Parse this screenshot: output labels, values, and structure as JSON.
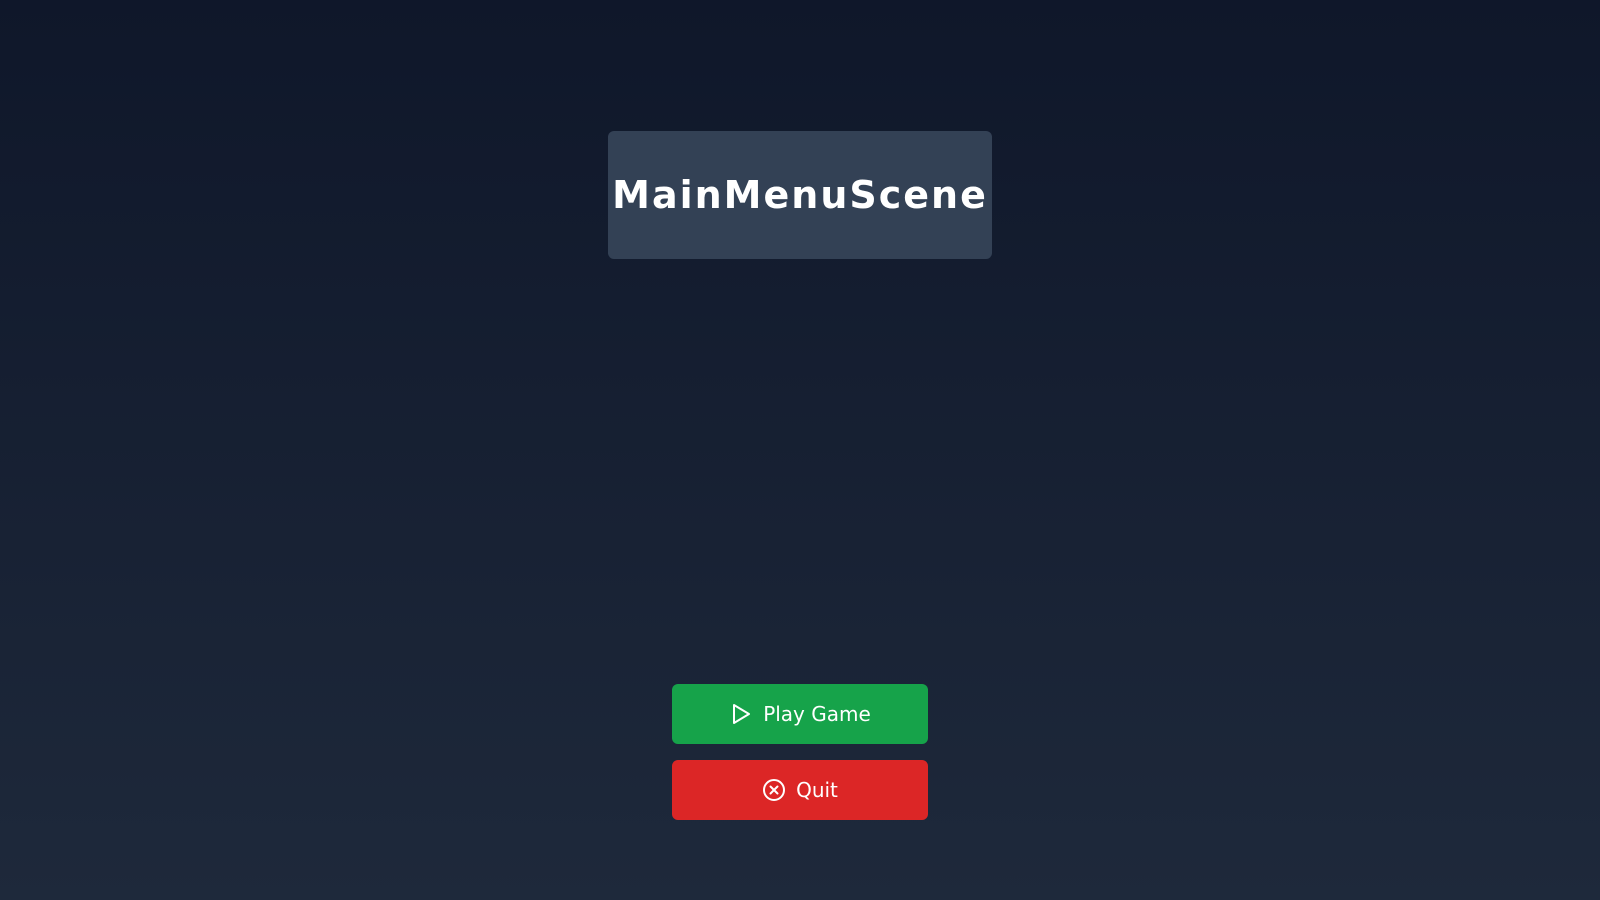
{
  "scene": {
    "title": "MainMenuScene",
    "background_top": "#0f172a",
    "background_bottom": "#1e293b",
    "panel_color": "#334155"
  },
  "menu": {
    "play": {
      "label": "Play Game",
      "icon": "play-icon",
      "color": "#16a34a"
    },
    "quit": {
      "label": "Quit",
      "icon": "close-circle-icon",
      "color": "#dc2626"
    }
  }
}
